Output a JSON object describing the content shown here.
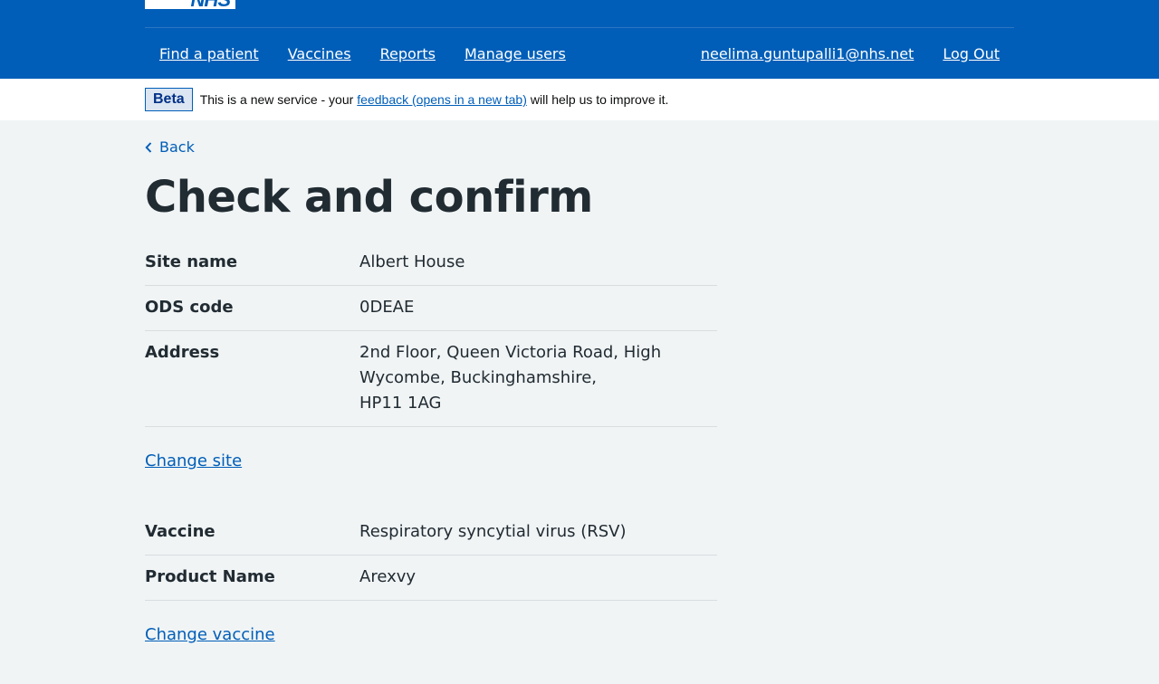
{
  "header": {
    "logo_text": "NHS",
    "nav_left": [
      "Find a patient",
      "Vaccines",
      "Reports",
      "Manage users"
    ],
    "user_email": "neelima.guntupalli1@nhs.net",
    "logout_label": "Log Out"
  },
  "beta": {
    "tag": "Beta",
    "text_before": "This is a new service - your",
    "link": "feedback (opens in a new tab)",
    "text_after": "will help us to improve it."
  },
  "main": {
    "back_label": "Back",
    "title": "Check and confirm",
    "site": {
      "rows": [
        {
          "key": "Site name",
          "value": "Albert House"
        },
        {
          "key": "ODS code",
          "value": "0DEAE"
        },
        {
          "key": "Address",
          "value_lines": [
            "2nd Floor, Queen Victoria Road, High Wycombe, Buckinghamshire,",
            "HP11 1AG"
          ]
        }
      ],
      "change_label": "Change site"
    },
    "vaccine": {
      "rows": [
        {
          "key": "Vaccine",
          "value": "Respiratory syncytial virus (RSV)"
        },
        {
          "key": "Product Name",
          "value": "Arexvy"
        }
      ],
      "change_label": "Change vaccine"
    }
  }
}
